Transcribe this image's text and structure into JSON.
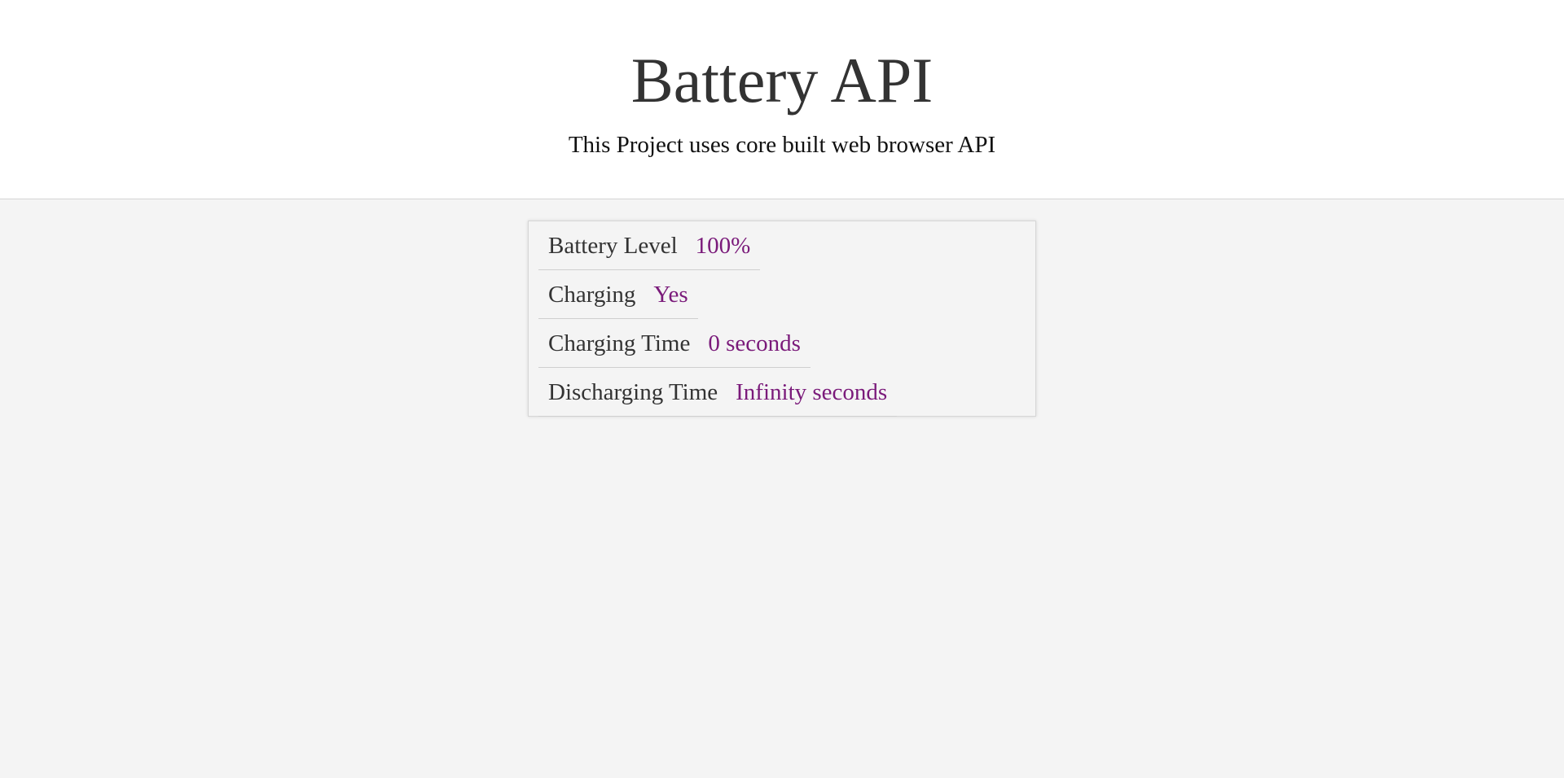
{
  "header": {
    "title": "Battery API",
    "subtitle": "This Project uses core built web browser API"
  },
  "battery": {
    "level_label": "Battery Level",
    "level_value": "100%",
    "charging_label": "Charging",
    "charging_value": "Yes",
    "charging_time_label": "Charging Time",
    "charging_time_value": "0 seconds",
    "discharging_time_label": "Discharging Time",
    "discharging_time_value": "Infinity seconds"
  },
  "colors": {
    "accent": "#7a1a7a",
    "background": "#f4f4f4",
    "header_background": "#ffffff",
    "text": "#333333"
  }
}
